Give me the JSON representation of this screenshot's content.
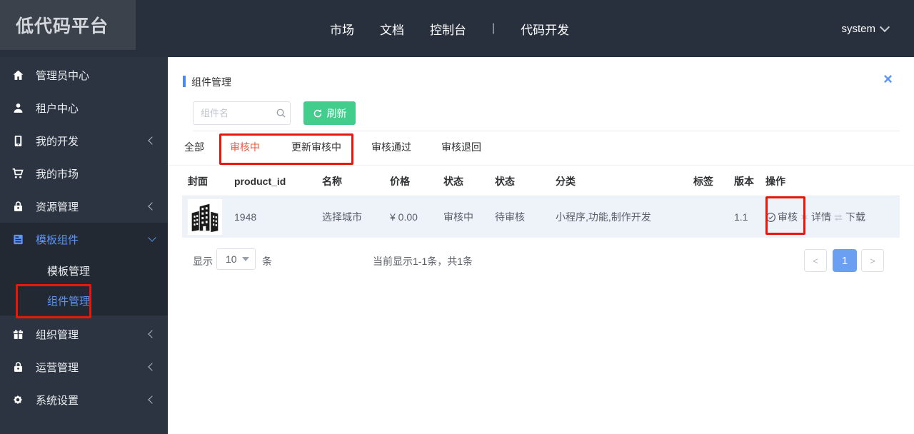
{
  "brand": {
    "logo_text": "低代码平台"
  },
  "topnav": {
    "items": [
      "市场",
      "文档",
      "控制台",
      "代码开发"
    ],
    "divider": "|",
    "user": {
      "name": "system"
    }
  },
  "sidebar": {
    "items": [
      {
        "label": "管理员中心",
        "icon": "home-icon"
      },
      {
        "label": "租户中心",
        "icon": "user-icon"
      },
      {
        "label": "我的开发",
        "icon": "mobile-icon",
        "chevron": "left"
      },
      {
        "label": "我的市场",
        "icon": "cart-icon",
        "chevron": null
      },
      {
        "label": "资源管理",
        "icon": "lock-icon",
        "chevron": "left"
      },
      {
        "label": "模板组件",
        "icon": "template-icon",
        "chevron": "down",
        "active": true,
        "children": [
          {
            "label": "模板管理",
            "active": false
          },
          {
            "label": "组件管理",
            "active": true,
            "annotated": true
          }
        ]
      },
      {
        "label": "组织管理",
        "icon": "gift-icon",
        "chevron": "left"
      },
      {
        "label": "运营管理",
        "icon": "lock-icon",
        "chevron": "left"
      },
      {
        "label": "系统设置",
        "icon": "gear-icon",
        "chevron": "left"
      }
    ]
  },
  "main": {
    "page_title": "组件管理",
    "close_icon": "×",
    "search": {
      "placeholder": "组件名"
    },
    "refresh_button": "刷新",
    "tabs": [
      "全部",
      "审核中",
      "更新审核中",
      "审核通过",
      "审核退回"
    ],
    "active_tab": "审核中",
    "table": {
      "headers": [
        "封面",
        "product_id",
        "名称",
        "价格",
        "状态",
        "状态",
        "分类",
        "标签",
        "版本",
        "操作"
      ],
      "rows": [
        {
          "cover": "buildings-image",
          "product_id": "1948",
          "name": "选择城市",
          "price": "¥ 0.00",
          "status1": "审核中",
          "status2": "待审核",
          "category": "小程序,功能,制作开发",
          "tags": "",
          "version": "1.1",
          "actions": [
            "审核",
            "详情",
            "下载"
          ]
        }
      ]
    },
    "pagination": {
      "show_label": "显示",
      "page_size": "10",
      "unit_label": "条",
      "summary": "当前显示1-1条，共1条",
      "prev": "<",
      "current": "1",
      "next": ">"
    }
  },
  "colors": {
    "accent_blue": "#5e94f5",
    "pager_blue": "#6b9ff2",
    "active_tab_red": "#f0593f",
    "annotation_red": "#e8170e",
    "button_green": "#42cd8d",
    "row_bg": "#eef3fa",
    "sidebar_bg": "#2b3440",
    "header_bg": "#28303d",
    "submenu_bg": "#222933"
  }
}
